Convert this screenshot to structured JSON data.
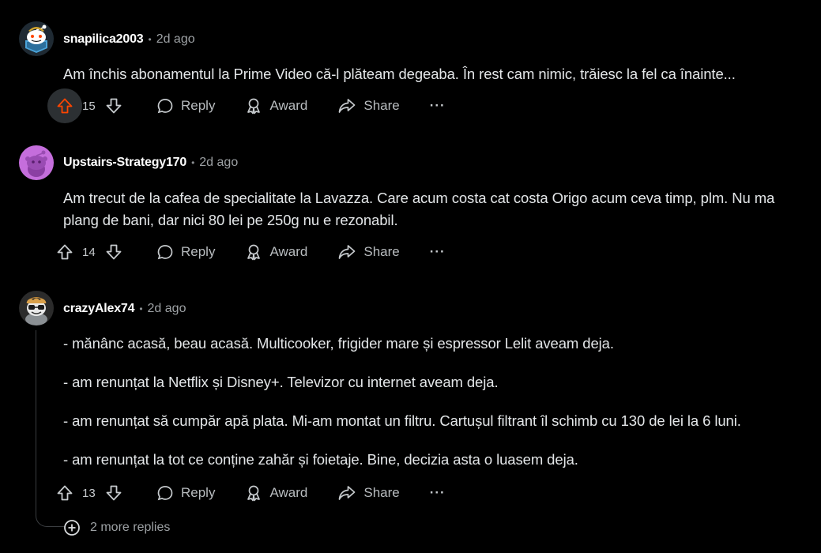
{
  "comments": [
    {
      "username": "snapilica2003",
      "time": "2d ago",
      "text": "Am închis abonamentul la Prime Video că-l plăteam degeaba. În rest cam nimic, trăiesc la fel ca înainte...",
      "votes": "15",
      "upvoted": true
    },
    {
      "username": "Upstairs-Strategy170",
      "time": "2d ago",
      "text": "Am trecut de la cafea de specialitate la Lavazza. Care acum costa cat costa Origo acum ceva timp, plm. Nu ma plang de bani, dar nici 80 lei pe 250g nu e rezonabil.",
      "votes": "14",
      "upvoted": false
    },
    {
      "username": "crazyAlex74",
      "time": "2d ago",
      "paragraphs": [
        "- mănânc acasă, beau acasă. Multicooker, frigider mare și espressor Lelit aveam deja.",
        "- am renunțat la Netflix și Disney+. Televizor cu internet aveam deja.",
        "- am renunțat să cumpăr apă plata. Mi-am montat un filtru. Cartușul filtrant îl schimb cu 130 de lei la 6 luni.",
        "- am renunțat la tot ce conține zahăr și foietaje. Bine, decizia asta o luasem deja."
      ],
      "votes": "13",
      "upvoted": false
    }
  ],
  "actions": {
    "reply": "Reply",
    "award": "Award",
    "share": "Share",
    "more": "···"
  },
  "more_replies": "2 more replies",
  "colors": {
    "background": "#000000",
    "upvote_active": "#ff4500",
    "text": "#e3e6e8",
    "muted": "#9da1a4"
  },
  "icons": [
    "upvote-icon",
    "downvote-icon",
    "reply-icon",
    "award-icon",
    "share-icon",
    "more-icon",
    "add-circle-icon"
  ]
}
